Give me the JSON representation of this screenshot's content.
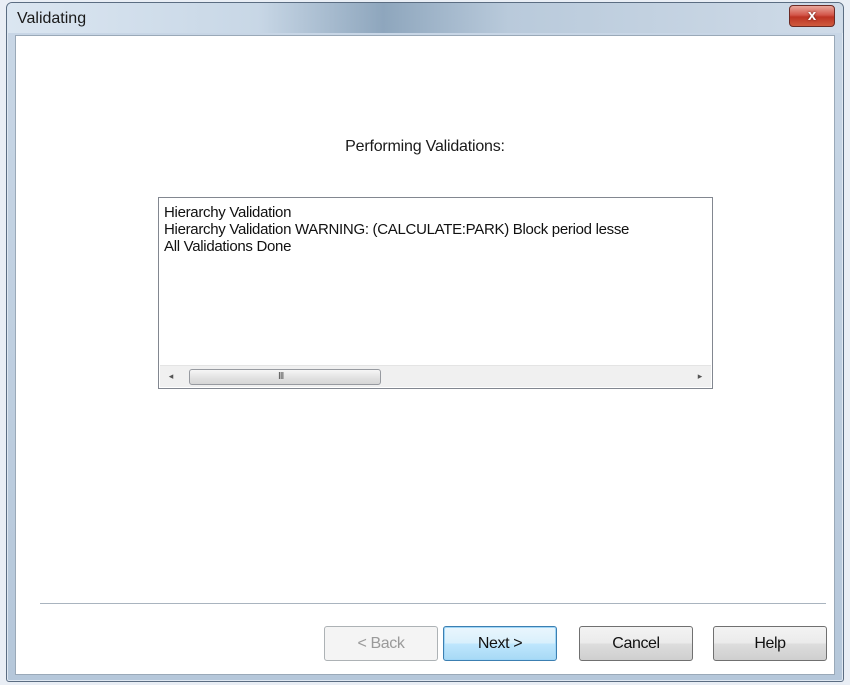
{
  "window": {
    "title": "Validating",
    "close_glyph": "x"
  },
  "main": {
    "heading": "Performing Validations:",
    "log_lines": [
      "Hierarchy Validation",
      "Hierarchy Validation WARNING:  (CALCULATE:PARK) Block period lesse",
      "All Validations Done"
    ],
    "scrollbar": {
      "left_arrow": "◂",
      "right_arrow": "▸",
      "grip": "III"
    }
  },
  "buttons": {
    "back": "< Back",
    "next": "Next >",
    "cancel": "Cancel",
    "help": "Help"
  }
}
